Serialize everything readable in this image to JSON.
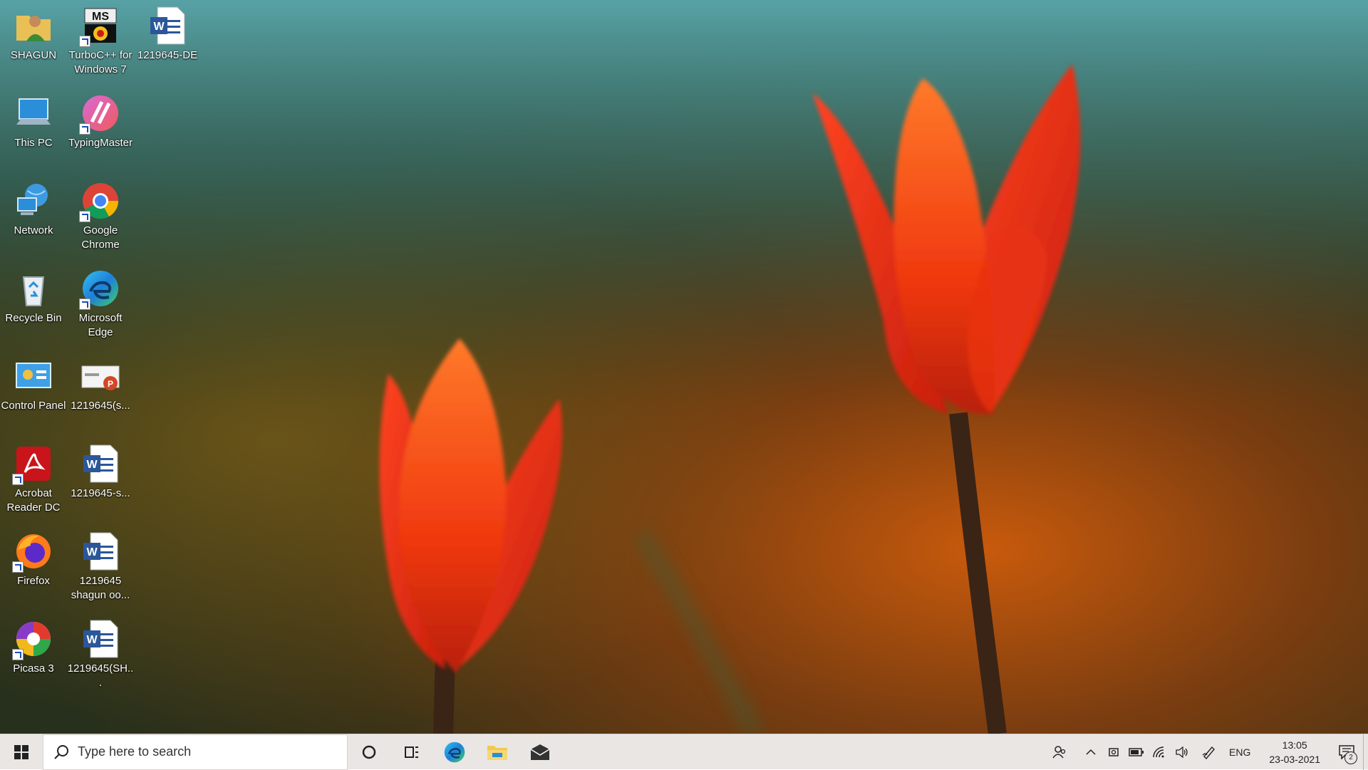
{
  "desktop_icons": [
    {
      "label": "SHAGUN",
      "icon": "user-folder-icon"
    },
    {
      "label": "TurboC++ for Windows 7",
      "icon": "turboc-icon"
    },
    {
      "label": "1219645-DE",
      "icon": "word-doc-icon"
    },
    {
      "label": "This PC",
      "icon": "computer-icon"
    },
    {
      "label": "TypingMaster",
      "icon": "typingmaster-icon"
    },
    {
      "label": "Network",
      "icon": "network-icon"
    },
    {
      "label": "Google Chrome",
      "icon": "chrome-icon"
    },
    {
      "label": "Recycle Bin",
      "icon": "recycle-bin-icon"
    },
    {
      "label": "Microsoft Edge",
      "icon": "edge-icon"
    },
    {
      "label": "Control Panel",
      "icon": "control-panel-icon"
    },
    {
      "label": "1219645(s...",
      "icon": "powerpoint-doc-icon"
    },
    {
      "label": "Acrobat Reader DC",
      "icon": "acrobat-icon"
    },
    {
      "label": "1219645-s...",
      "icon": "word-doc-icon"
    },
    {
      "label": "Firefox",
      "icon": "firefox-icon"
    },
    {
      "label": "1219645 shagun oo...",
      "icon": "word-doc-icon"
    },
    {
      "label": "Picasa 3",
      "icon": "picasa-icon"
    },
    {
      "label": "1219645(SH...",
      "icon": "word-doc-icon"
    }
  ],
  "turboc_badge": "MS",
  "taskbar": {
    "search_placeholder": "Type here to search",
    "language": "ENG",
    "time": "13:05",
    "date": "23-03-2021",
    "notification_count": "2",
    "pinned": [
      "cortana-icon",
      "task-view-icon",
      "edge-icon",
      "file-explorer-icon",
      "mail-icon"
    ]
  },
  "colors": {
    "taskbar_bg": "#e9e6e4",
    "tulip_orange": "#ff5a1f",
    "wallpaper_teal": "#4a9a9e"
  }
}
